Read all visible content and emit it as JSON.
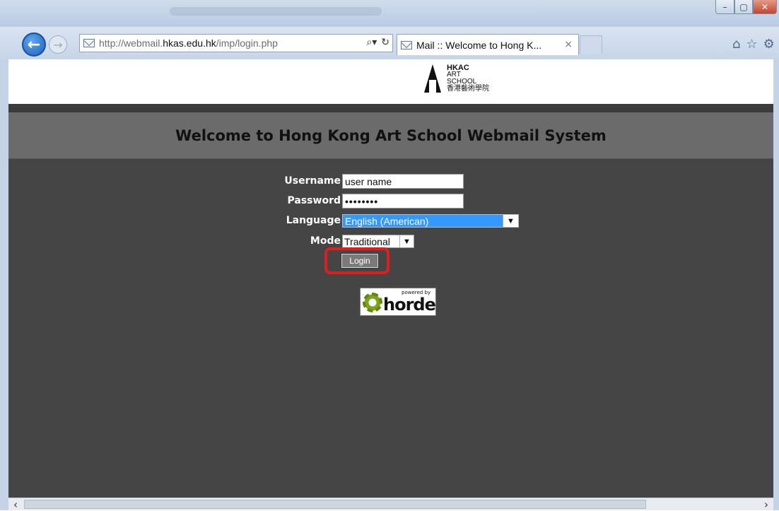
{
  "browser": {
    "url_prefix": "http://webmail.",
    "url_host": "hkas.edu.hk",
    "url_path": "/imp/login.php",
    "tab_title": "Mail :: Welcome to Hong K...",
    "tab_close": "×",
    "addr_search_icon": "search-icon",
    "addr_refresh_icon": "refresh-icon"
  },
  "window_controls": {
    "minimize": "–",
    "maximize": "▢",
    "close": "✕"
  },
  "logo": {
    "line1": "HKAC",
    "line2": "ART",
    "line3": "SCHOOL",
    "line4": "香港藝術學院"
  },
  "page": {
    "welcome": "Welcome to Hong Kong Art School Webmail System"
  },
  "form": {
    "username_label": "Username",
    "username_value": "user name",
    "password_label": "Password",
    "password_value": "••••••••",
    "language_label": "Language",
    "language_value": "English (American)",
    "mode_label": "Mode",
    "mode_value": "Traditional",
    "login_label": "Login"
  },
  "horde": {
    "small": "powered by",
    "word": "horde"
  },
  "icons": {
    "home": "home-icon",
    "favorites": "star-icon",
    "settings": "gear-icon"
  },
  "colors": {
    "page_bg": "#454545",
    "welcome_band": "#6b6b6b",
    "highlight": "#e01e1e",
    "language_select": "#3399ff"
  }
}
